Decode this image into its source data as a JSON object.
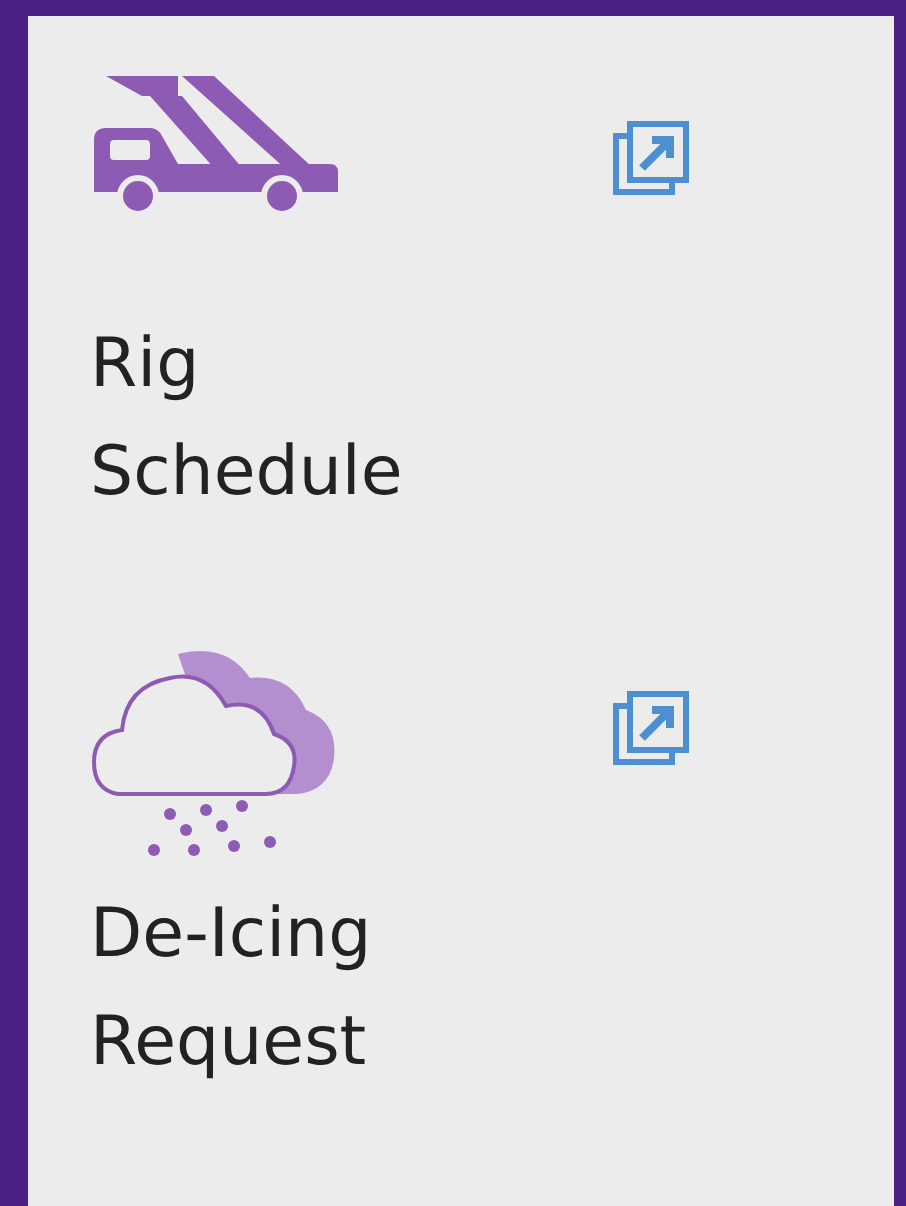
{
  "tiles": [
    {
      "kind": "rig",
      "label": "Rig Schedule"
    },
    {
      "kind": "deicing",
      "label": "De-Icing Request"
    }
  ]
}
